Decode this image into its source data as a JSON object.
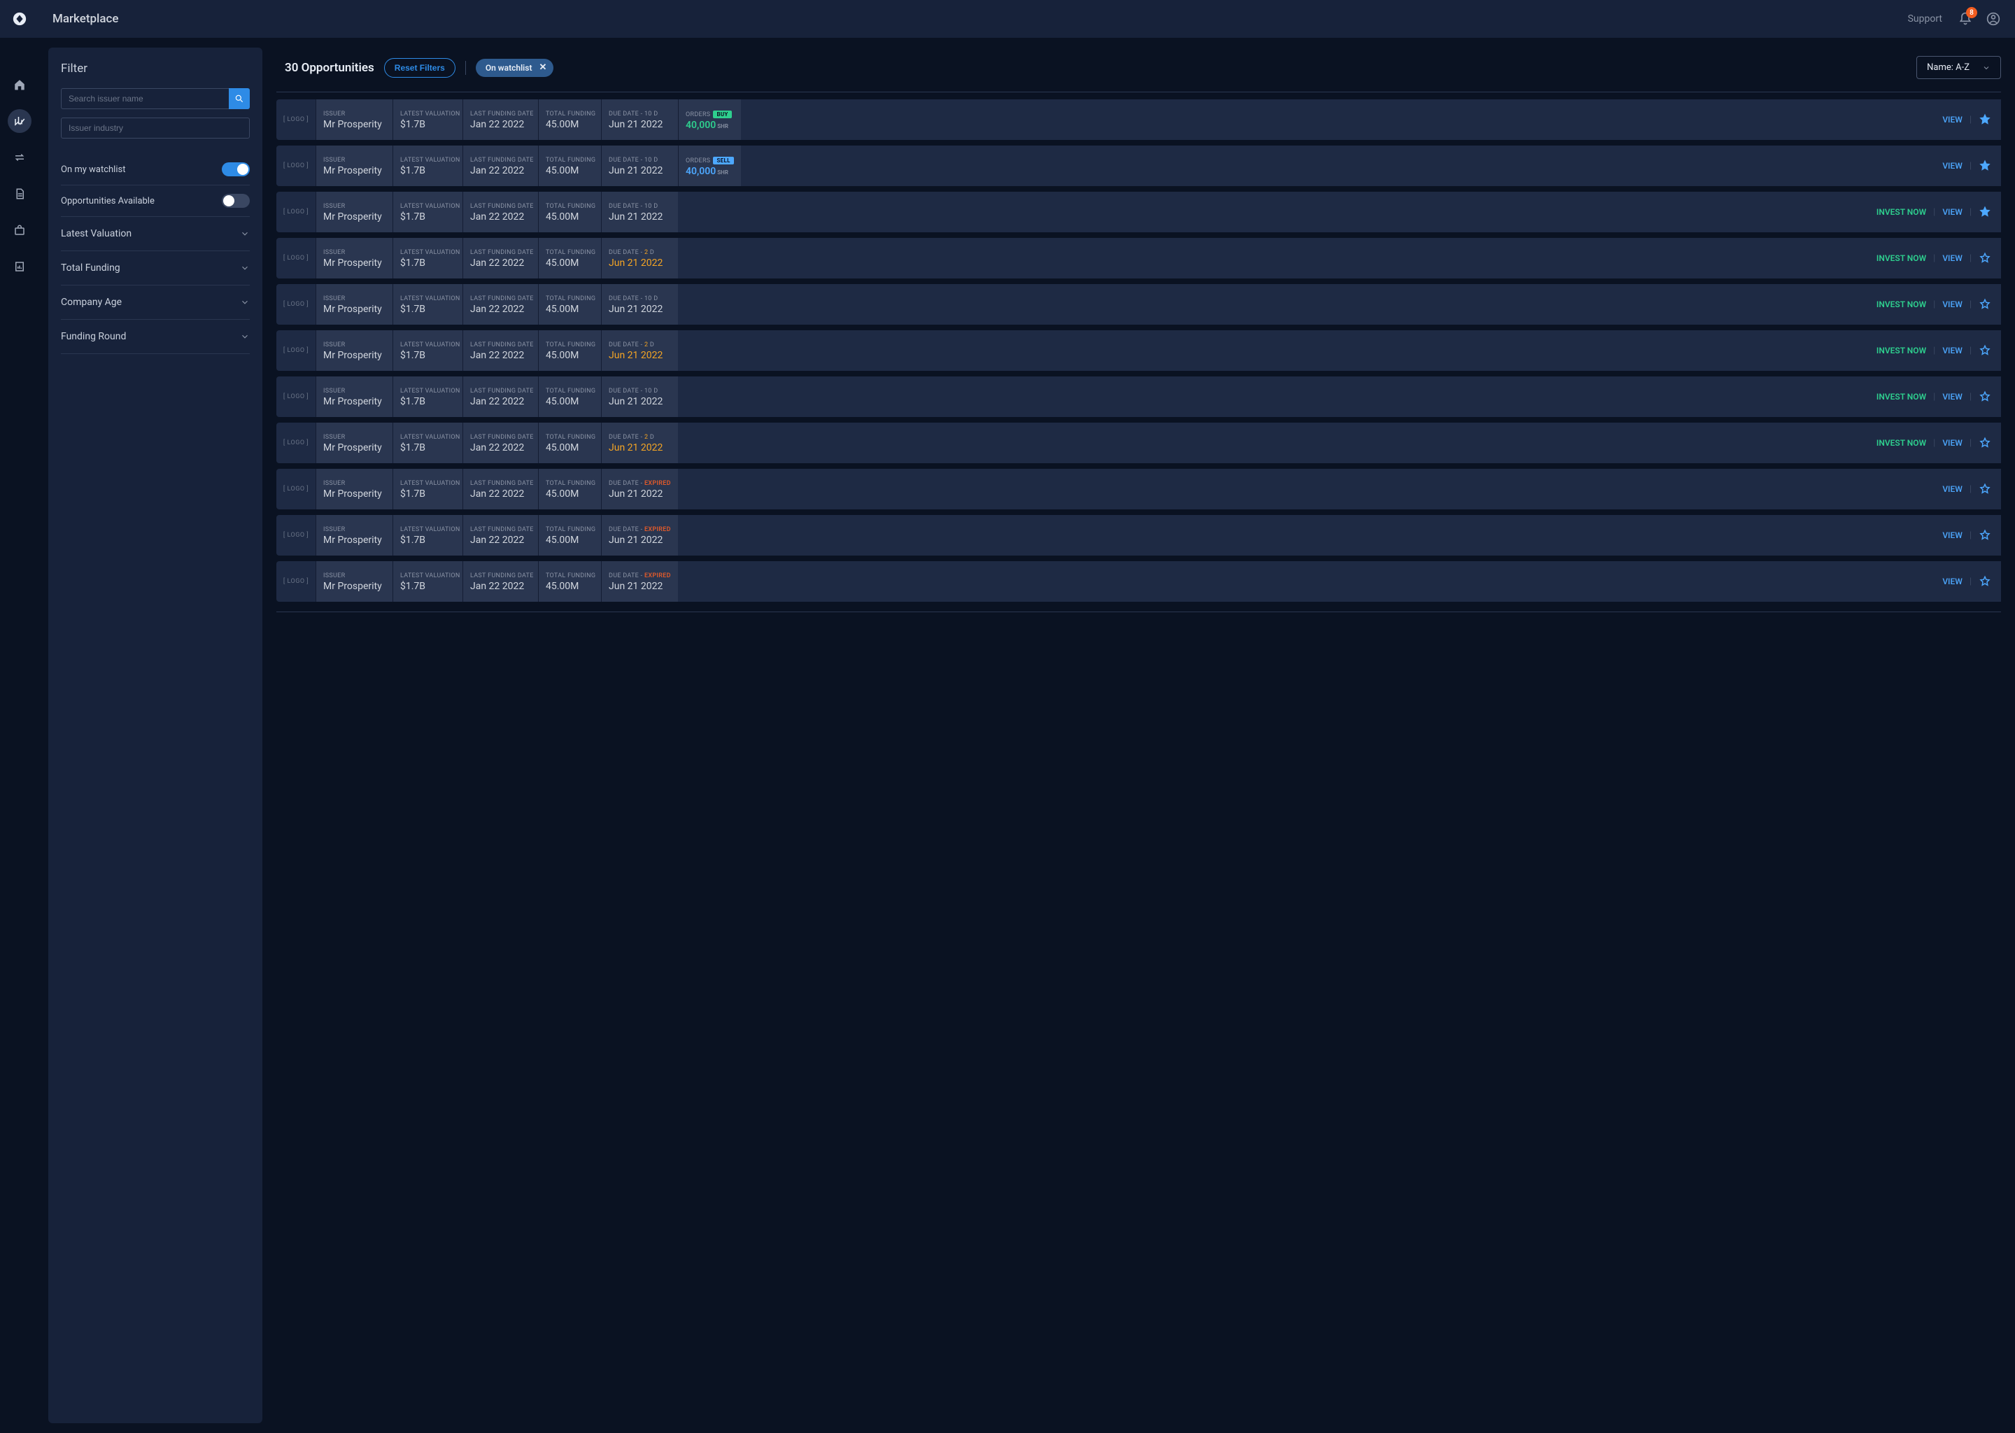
{
  "header": {
    "page_title": "Marketplace",
    "support": "Support",
    "notification_count": "8"
  },
  "filter": {
    "title": "Filter",
    "search_placeholder": "Search issuer name",
    "industry_placeholder": "Issuer industry",
    "toggles": [
      {
        "label": "On my watchlist",
        "on": true
      },
      {
        "label": "Opportunities Available",
        "on": false
      }
    ],
    "accordions": [
      "Latest Valuation",
      "Total Funding",
      "Company Age",
      "Funding Round"
    ]
  },
  "main": {
    "count_label": "30 Opportunities",
    "reset": "Reset Filters",
    "chip": "On watchlist",
    "sort": "Name: A-Z"
  },
  "labels": {
    "logo": "[ LOGO ]",
    "issuer": "ISSUER",
    "valuation": "LATEST VALUATION",
    "last_funding": "LAST FUNDING DATE",
    "total_funding": "TOTAL FUNDING",
    "due_date": "DUE DATE",
    "orders": "ORDERS",
    "invest": "INVEST NOW",
    "view": "VIEW",
    "shr": "SHR",
    "buy": "BUY",
    "sell": "SELL",
    "expired": "EXPIRED"
  },
  "rows": [
    {
      "issuer": "Mr Prosperity",
      "val": "$1.7B",
      "lfd": "Jan 22 2022",
      "tf": "45.00M",
      "due": "Jun 21 2022",
      "days": "10",
      "warn": false,
      "expired": false,
      "orders": "40,000",
      "orderType": "buy",
      "invest": false,
      "star": true
    },
    {
      "issuer": "Mr Prosperity",
      "val": "$1.7B",
      "lfd": "Jan 22 2022",
      "tf": "45.00M",
      "due": "Jun 21 2022",
      "days": "10",
      "warn": false,
      "expired": false,
      "orders": "40,000",
      "orderType": "sell",
      "invest": false,
      "star": true
    },
    {
      "issuer": "Mr Prosperity",
      "val": "$1.7B",
      "lfd": "Jan 22 2022",
      "tf": "45.00M",
      "due": "Jun 21 2022",
      "days": "10",
      "warn": false,
      "expired": false,
      "orders": null,
      "orderType": null,
      "invest": true,
      "star": true
    },
    {
      "issuer": "Mr Prosperity",
      "val": "$1.7B",
      "lfd": "Jan 22 2022",
      "tf": "45.00M",
      "due": "Jun 21 2022",
      "days": "2",
      "warn": true,
      "expired": false,
      "orders": null,
      "orderType": null,
      "invest": true,
      "star": false
    },
    {
      "issuer": "Mr Prosperity",
      "val": "$1.7B",
      "lfd": "Jan 22 2022",
      "tf": "45.00M",
      "due": "Jun 21 2022",
      "days": "10",
      "warn": false,
      "expired": false,
      "orders": null,
      "orderType": null,
      "invest": true,
      "star": false
    },
    {
      "issuer": "Mr Prosperity",
      "val": "$1.7B",
      "lfd": "Jan 22 2022",
      "tf": "45.00M",
      "due": "Jun 21 2022",
      "days": "2",
      "warn": true,
      "expired": false,
      "orders": null,
      "orderType": null,
      "invest": true,
      "star": false
    },
    {
      "issuer": "Mr Prosperity",
      "val": "$1.7B",
      "lfd": "Jan 22 2022",
      "tf": "45.00M",
      "due": "Jun 21 2022",
      "days": "10",
      "warn": false,
      "expired": false,
      "orders": null,
      "orderType": null,
      "invest": true,
      "star": false
    },
    {
      "issuer": "Mr Prosperity",
      "val": "$1.7B",
      "lfd": "Jan 22 2022",
      "tf": "45.00M",
      "due": "Jun 21 2022",
      "days": "2",
      "warn": true,
      "expired": false,
      "orders": null,
      "orderType": null,
      "invest": true,
      "star": false
    },
    {
      "issuer": "Mr Prosperity",
      "val": "$1.7B",
      "lfd": "Jan 22 2022",
      "tf": "45.00M",
      "due": "Jun 21 2022",
      "days": null,
      "warn": false,
      "expired": true,
      "orders": null,
      "orderType": null,
      "invest": false,
      "star": false
    },
    {
      "issuer": "Mr Prosperity",
      "val": "$1.7B",
      "lfd": "Jan 22 2022",
      "tf": "45.00M",
      "due": "Jun 21 2022",
      "days": null,
      "warn": false,
      "expired": true,
      "orders": null,
      "orderType": null,
      "invest": false,
      "star": false
    },
    {
      "issuer": "Mr Prosperity",
      "val": "$1.7B",
      "lfd": "Jan 22 2022",
      "tf": "45.00M",
      "due": "Jun 21 2022",
      "days": null,
      "warn": false,
      "expired": true,
      "orders": null,
      "orderType": null,
      "invest": false,
      "star": false
    }
  ]
}
